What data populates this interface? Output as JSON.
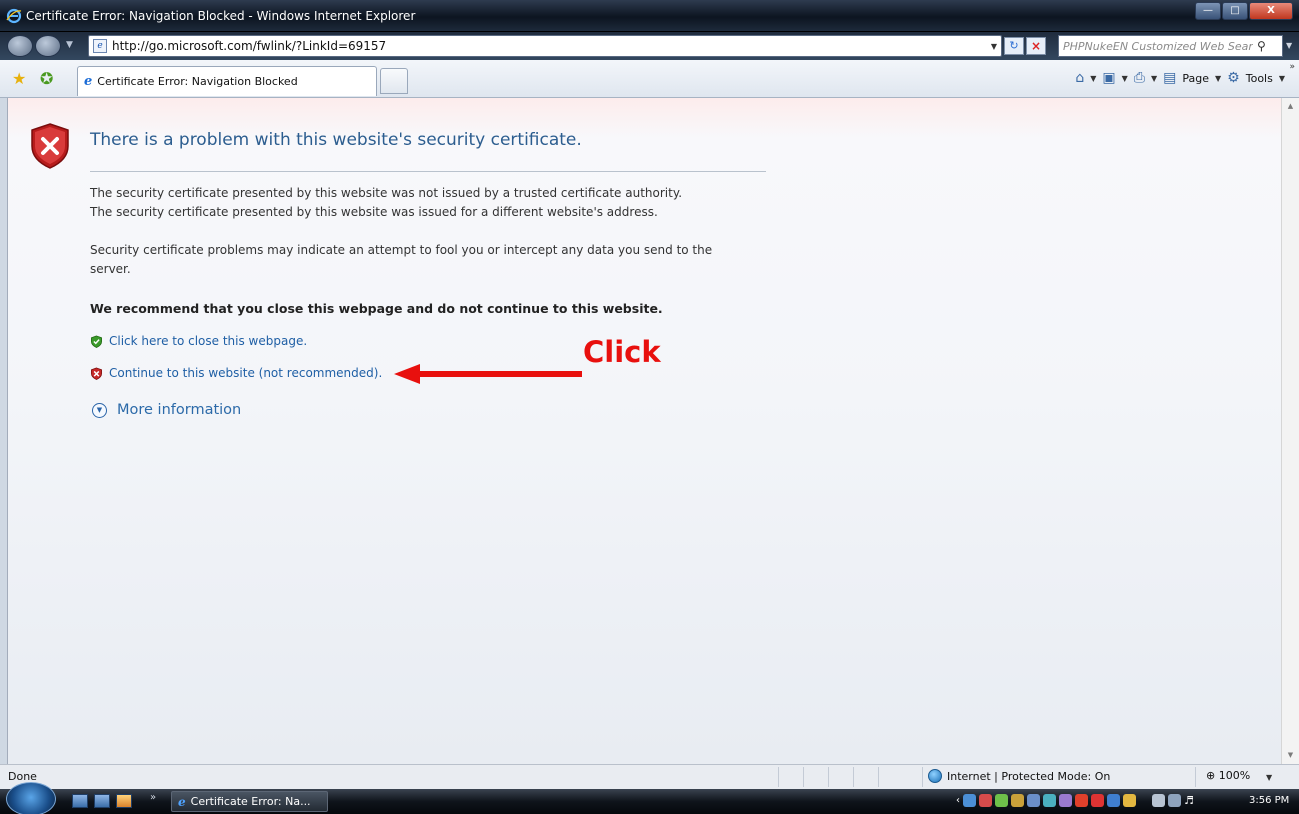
{
  "window": {
    "title": "Certificate Error: Navigation Blocked - Windows Internet Explorer"
  },
  "address_bar": {
    "url": "http://go.microsoft.com/fwlink/?LinkId=69157"
  },
  "search": {
    "placeholder": "PHPNukeEN Customized Web Searc"
  },
  "tab": {
    "label": "Certificate Error: Navigation Blocked"
  },
  "command_bar": {
    "page_label": "Page",
    "tools_label": "Tools"
  },
  "content": {
    "heading": "There is a problem with this website's security certificate.",
    "para1": "The security certificate presented by this website was not issued by a trusted certificate authority.",
    "para2": "The security certificate presented by this website was issued for a different website's address.",
    "para3": "Security certificate problems may indicate an attempt to fool you or intercept any data you send to the server.",
    "recommend": "We recommend that you close this webpage and do not continue to this website.",
    "close_link": "Click here to close this webpage.",
    "continue_link": "Continue to this website (not recommended).",
    "more_info": "More information"
  },
  "annotation": {
    "label": "Click",
    "color": "#e8100e"
  },
  "status_bar": {
    "status": "Done",
    "zone": "Internet | Protected Mode: On",
    "zoom": "100%"
  },
  "taskbar": {
    "task_label": "Certificate Error: Na...",
    "clock": "3:56 PM"
  },
  "icons": {
    "title": "ie-icon",
    "shield": "shield-error-icon",
    "close_link": "shield-ok-icon",
    "continue_link": "shield-error-icon",
    "more_info": "expand-circle-icon"
  }
}
